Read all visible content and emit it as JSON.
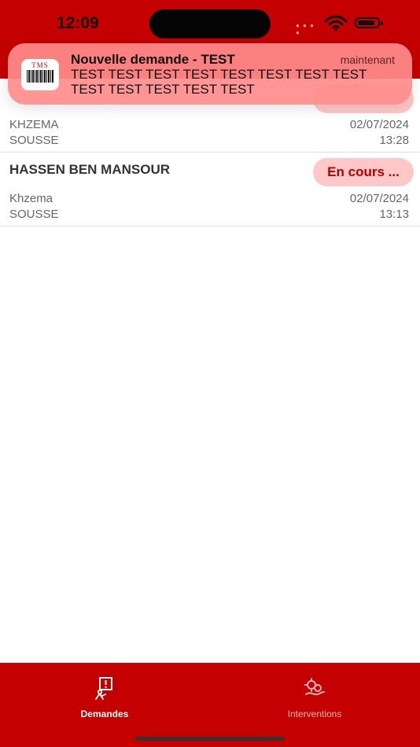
{
  "status_bar": {
    "time": "12:09",
    "signal_icon": "signal-dots-icon",
    "wifi_icon": "wifi-icon",
    "battery_icon": "battery-icon",
    "battery_level": 0.8
  },
  "notification": {
    "app_icon": "app-logo-icon",
    "app_icon_text": "TMS",
    "title": "Nouvelle demande - TEST",
    "time": "maintenant",
    "body": "TEST TEST TEST TEST TEST TEST TEST TEST TEST TEST TEST TEST TEST"
  },
  "list": {
    "items": [
      {
        "title": "",
        "status": "",
        "place": "KHZEMA",
        "city": "SOUSSE",
        "date": "02/07/2024",
        "time": "13:28"
      },
      {
        "title": "HASSEN BEN MANSOUR",
        "status": "En cours ...",
        "place": "Khzema",
        "city": "SOUSSE",
        "date": "02/07/2024",
        "time": "13:13"
      }
    ]
  },
  "tabbar": {
    "demandes": {
      "label": "Demandes",
      "icon": "request-form-icon"
    },
    "interventions": {
      "label": "Interventions",
      "icon": "gears-hand-icon"
    }
  },
  "colors": {
    "brand_red": "#c50000",
    "badge_background": "#ffc8c8",
    "badge_text": "#b40000"
  }
}
